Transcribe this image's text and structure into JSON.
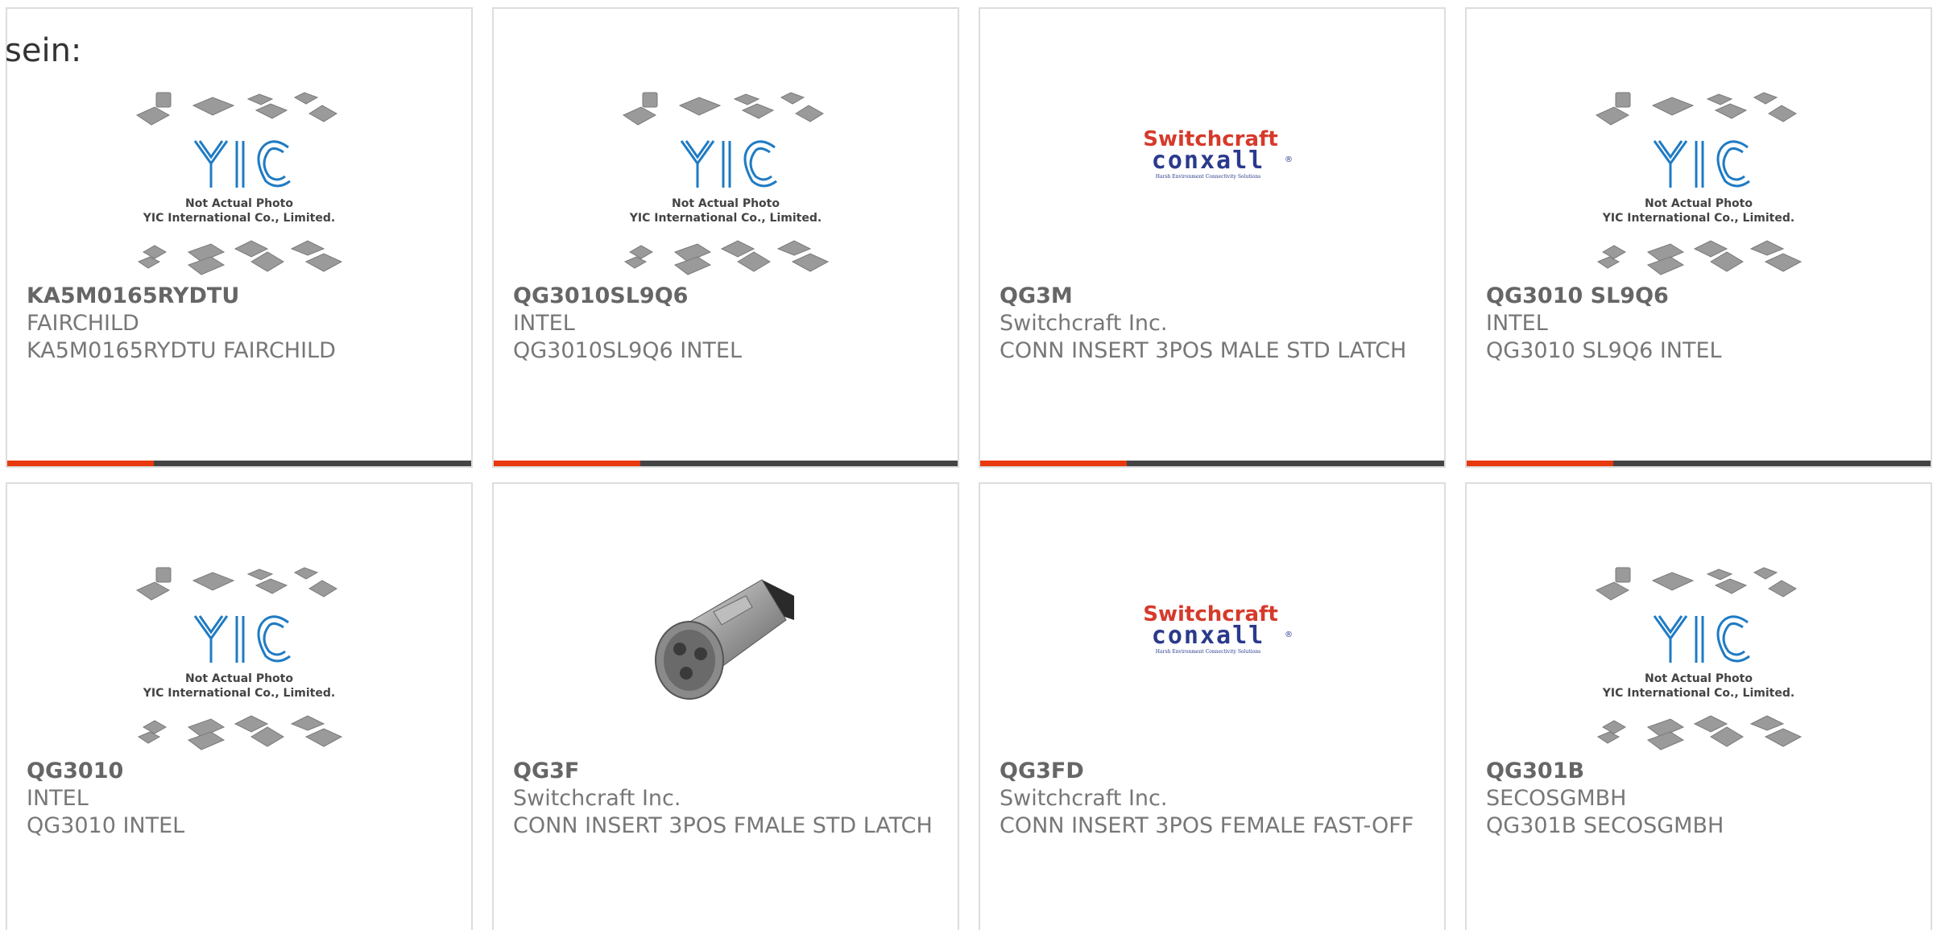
{
  "lead_text": "sein:",
  "colors": {
    "accent": "#e8390e",
    "bar": "#444444",
    "border": "#dddddd",
    "text": "#777777",
    "yic_blue": "#1f7bc4",
    "switchcraft_red": "#d63a2b",
    "conxall_blue": "#2a3a8c"
  },
  "placeholder_graphic": {
    "line1": "Not Actual Photo",
    "line2": "YIC International Co., Limited."
  },
  "logos": {
    "switchcraft": "Switchcraft",
    "conxall": "conxall",
    "tagline": "Harsh Environment Connectivity Solutions",
    "registered": "®"
  },
  "products": [
    {
      "part_number": "KA5M0165RYDTU",
      "manufacturer": "FAIRCHILD",
      "description": "KA5M0165RYDTU FAIRCHILD",
      "image": "yic-placeholder"
    },
    {
      "part_number": "QG3010SL9Q6",
      "manufacturer": "INTEL",
      "description": "QG3010SL9Q6 INTEL",
      "image": "yic-placeholder"
    },
    {
      "part_number": "QG3M",
      "manufacturer": "Switchcraft Inc.",
      "description": "CONN INSERT 3POS MALE STD LATCH",
      "image": "switchcraft-logo"
    },
    {
      "part_number": "QG3010 SL9Q6",
      "manufacturer": "INTEL",
      "description": "QG3010 SL9Q6 INTEL",
      "image": "yic-placeholder"
    },
    {
      "part_number": "QG3010",
      "manufacturer": "INTEL",
      "description": "QG3010 INTEL",
      "image": "yic-placeholder"
    },
    {
      "part_number": "QG3F",
      "manufacturer": "Switchcraft Inc.",
      "description": "CONN INSERT 3POS FMALE STD LATCH",
      "image": "xlr-connector-photo"
    },
    {
      "part_number": "QG3FD",
      "manufacturer": "Switchcraft Inc.",
      "description": "CONN INSERT 3POS FEMALE FAST-OFF",
      "image": "switchcraft-logo"
    },
    {
      "part_number": "QG301B",
      "manufacturer": "SECOSGMBH",
      "description": "QG301B SECOSGMBH",
      "image": "yic-placeholder"
    }
  ]
}
